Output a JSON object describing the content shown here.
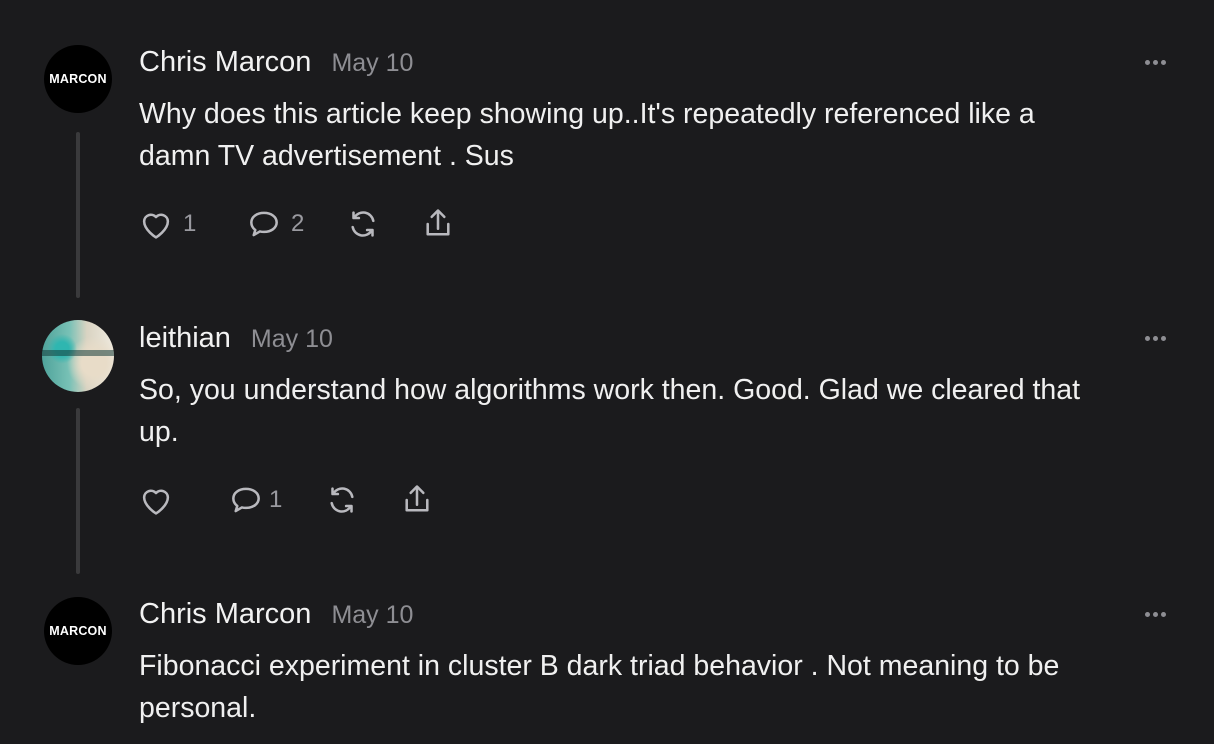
{
  "comments": [
    {
      "avatar_text": "MARCON",
      "author": "Chris Marcon",
      "date": "May 10",
      "text_line1": "Why does this article keep showing up..It's repeatedly referenced like a",
      "text_line2": "damn TV advertisement . Sus",
      "likes": "1",
      "replies": "2"
    },
    {
      "author": "leithian",
      "date": "May 10",
      "text_line1": "So, you understand how algorithms work then. Good. Glad we cleared that",
      "text_line2": "up.",
      "likes": "",
      "replies": "1"
    },
    {
      "avatar_text": "MARCON",
      "author": "Chris Marcon",
      "date": "May 10",
      "text_line1": "Fibonacci experiment in cluster B dark triad behavior . Not meaning to be",
      "text_line2": "personal."
    }
  ]
}
